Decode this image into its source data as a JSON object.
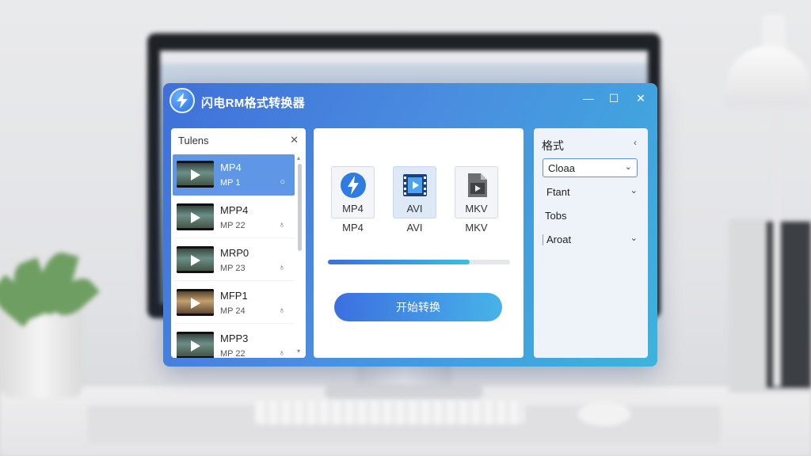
{
  "app": {
    "title": "闪电RM格式转换器",
    "minimize": "—",
    "maximize": "☐",
    "close": "✕"
  },
  "files_panel": {
    "title": "Tulens",
    "close": "✕",
    "items": [
      {
        "name": "MP4",
        "sub": "MP 1",
        "status": "○",
        "active": true
      },
      {
        "name": "MPP4",
        "sub": "MP 22",
        "status": "♁",
        "active": false
      },
      {
        "name": "MRP0",
        "sub": "MP 23",
        "status": "♁",
        "active": false
      },
      {
        "name": "MFP1",
        "sub": "MP 24",
        "status": "♁",
        "active": false
      },
      {
        "name": "MPP3",
        "sub": "MP 22",
        "status": "♁",
        "active": false
      }
    ],
    "scroll_up": "▴",
    "scroll_down": "▾"
  },
  "converter": {
    "formats": [
      {
        "card_label": "MP4",
        "label": "MP4",
        "icon": "lightning-icon",
        "selected": false
      },
      {
        "card_label": "AVI",
        "label": "AVI",
        "icon": "film-icon",
        "selected": true
      },
      {
        "card_label": "MKV",
        "label": "MKV",
        "icon": "video-file-icon",
        "selected": false
      }
    ],
    "progress": 0.78,
    "start_button": "开始转换"
  },
  "settings_panel": {
    "title": "格式",
    "collapse": "‹",
    "select_value": "Cloaa",
    "rows": [
      {
        "label": "Ftant",
        "chevron": "⌄"
      },
      {
        "label": "Tobs",
        "chevron": ""
      },
      {
        "label": "Aroat",
        "chevron": "⌄"
      }
    ],
    "select_chevron": "⌄"
  },
  "colors": {
    "window_gradient_start": "#3f70d9",
    "window_gradient_end": "#3bb4dd",
    "accent": "#5e8fe0",
    "active_item": "#5f97e6"
  }
}
